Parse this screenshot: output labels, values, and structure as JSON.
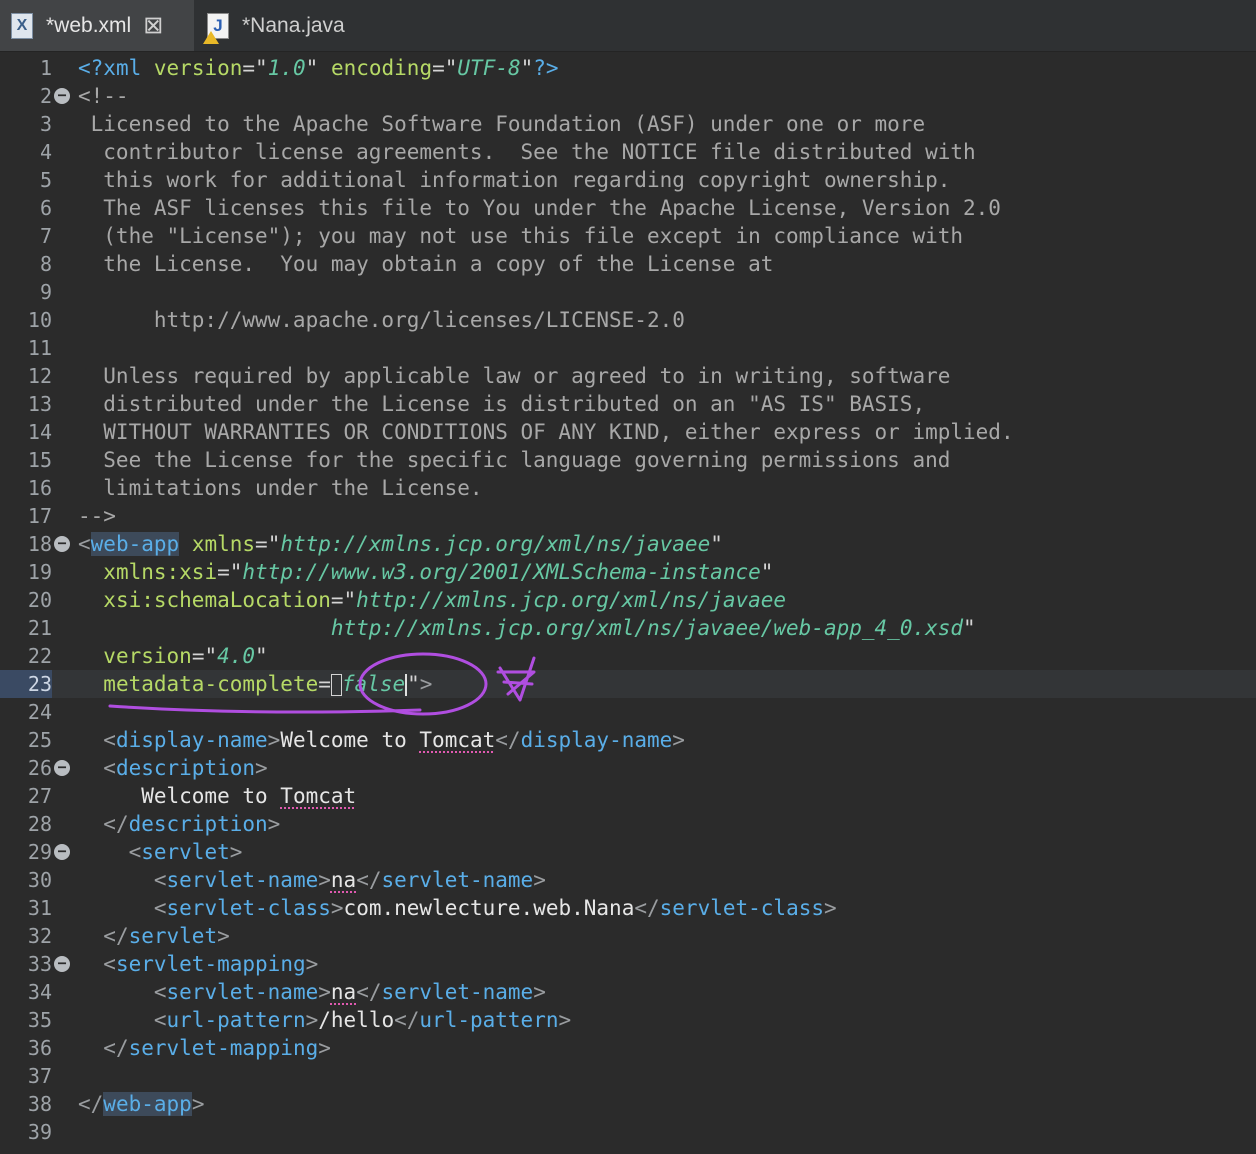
{
  "tabs": [
    {
      "label": "*web.xml",
      "icon": "xml-file-icon",
      "active": true
    },
    {
      "label": "*Nana.java",
      "icon": "java-file-icon",
      "active": false
    }
  ],
  "colors": {
    "background": "#2b2b2b",
    "tag": "#5aaee8",
    "attribute": "#b6d966",
    "value": "#67c8a4",
    "comment": "#a8a8a8",
    "annotation": "#b04ee0"
  },
  "lines": [
    {
      "n": "1"
    },
    {
      "n": "2"
    },
    {
      "n": "3"
    },
    {
      "n": "4"
    },
    {
      "n": "5"
    },
    {
      "n": "6"
    },
    {
      "n": "7"
    },
    {
      "n": "8"
    },
    {
      "n": "9"
    },
    {
      "n": "10"
    },
    {
      "n": "11"
    },
    {
      "n": "12"
    },
    {
      "n": "13"
    },
    {
      "n": "14"
    },
    {
      "n": "15"
    },
    {
      "n": "16"
    },
    {
      "n": "17"
    },
    {
      "n": "18"
    },
    {
      "n": "19"
    },
    {
      "n": "20"
    },
    {
      "n": "21"
    },
    {
      "n": "22"
    },
    {
      "n": "23"
    },
    {
      "n": "24"
    },
    {
      "n": "25"
    },
    {
      "n": "26"
    },
    {
      "n": "27"
    },
    {
      "n": "28"
    },
    {
      "n": "29"
    },
    {
      "n": "30"
    },
    {
      "n": "31"
    },
    {
      "n": "32"
    },
    {
      "n": "33"
    },
    {
      "n": "34"
    },
    {
      "n": "35"
    },
    {
      "n": "36"
    },
    {
      "n": "37"
    },
    {
      "n": "38"
    },
    {
      "n": "39"
    }
  ],
  "code": {
    "l1": {
      "open": "<?",
      "xml": "xml",
      "a1": "version",
      "v1": "1.0",
      "a2": "encoding",
      "v2": "UTF-8",
      "close": "?>"
    },
    "l2": "<!--",
    "l3": " Licensed to the Apache Software Foundation (ASF) under one or more",
    "l4": "  contributor license agreements.  See the NOTICE file distributed with",
    "l5": "  this work for additional information regarding copyright ownership.",
    "l6": "  The ASF licenses this file to You under the Apache License, Version 2.0",
    "l7": "  (the \"License\"); you may not use this file except in compliance with",
    "l8": "  the License.  You may obtain a copy of the License at",
    "l10": "      http://www.apache.org/licenses/LICENSE-2.0",
    "l12": "  Unless required by applicable law or agreed to in writing, software",
    "l13": "  distributed under the License is distributed on an \"AS IS\" BASIS,",
    "l14": "  WITHOUT WARRANTIES OR CONDITIONS OF ANY KIND, either express or implied.",
    "l15": "  See the License for the specific language governing permissions and",
    "l16": "  limitations under the License.",
    "l17": "-->",
    "web_app": "web-app",
    "xmlns_attr": "xmlns",
    "xmlns_val": "http://xmlns.jcp.org/xml/ns/javaee",
    "xsi_attr": "xmlns:xsi",
    "xsi_val": "http://www.w3.org/2001/XMLSchema-instance",
    "schema_attr": "xsi:schemaLocation",
    "schema_val1": "http://xmlns.jcp.org/xml/ns/javaee",
    "schema_val2": "http://xmlns.jcp.org/xml/ns/javaee/web-app_4_0.xsd",
    "version_attr": "version",
    "version_val": "4.0",
    "meta_attr": "metadata-complete",
    "meta_val": "false",
    "display_name": "display-name",
    "display_text_a": "Welcome to ",
    "display_text_b": "Tomcat",
    "description": "description",
    "desc_text_a": "Welcome to ",
    "desc_text_b": "Tomcat",
    "servlet": "servlet",
    "servlet_name": "servlet-name",
    "servlet_name_val": "na",
    "servlet_class": "servlet-class",
    "servlet_class_val": "com.newlecture.web.Nana",
    "servlet_mapping": "servlet-mapping",
    "url_pattern": "url-pattern",
    "url_pattern_val": "/hello"
  }
}
